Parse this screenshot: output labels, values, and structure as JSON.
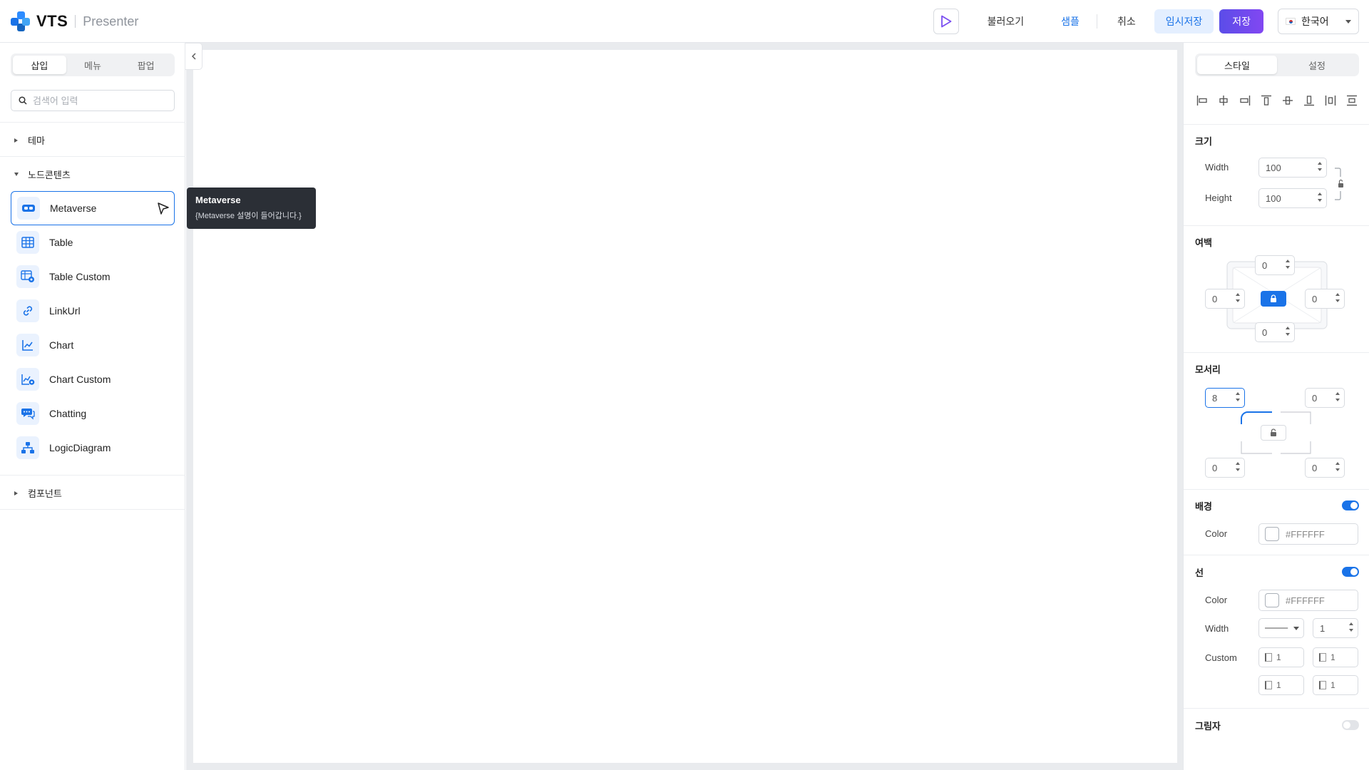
{
  "header": {
    "logo_text": "VTS",
    "logo_sub": "Presenter",
    "load_label": "불러오기",
    "sample_label": "샘플",
    "cancel_label": "취소",
    "temp_save_label": "임시저장",
    "save_label": "저장",
    "language": "한국어"
  },
  "left": {
    "tabs": [
      "삽입",
      "메뉴",
      "팝업"
    ],
    "search_placeholder": "검색어 입력",
    "sections": {
      "theme": "테마",
      "node_contents": "노드콘텐츠",
      "components": "컴포넌트"
    },
    "items": [
      {
        "label": "Metaverse",
        "icon": "vr-headset-icon"
      },
      {
        "label": "Table",
        "icon": "table-icon"
      },
      {
        "label": "Table Custom",
        "icon": "table-custom-icon"
      },
      {
        "label": "LinkUrl",
        "icon": "link-icon"
      },
      {
        "label": "Chart",
        "icon": "chart-icon"
      },
      {
        "label": "Chart Custom",
        "icon": "chart-custom-icon"
      },
      {
        "label": "Chatting",
        "icon": "chat-icon"
      },
      {
        "label": "LogicDiagram",
        "icon": "diagram-icon"
      }
    ]
  },
  "tooltip": {
    "title": "Metaverse",
    "desc": "{Metaverse 설명이 들어갑니다.}"
  },
  "right": {
    "tabs": [
      "스타일",
      "설정"
    ],
    "size": {
      "title": "크기",
      "width_label": "Width",
      "width": "100",
      "height_label": "Height",
      "height": "100"
    },
    "margin": {
      "title": "여백",
      "top": "0",
      "left": "0",
      "right": "0",
      "bottom": "0"
    },
    "corner": {
      "title": "모서리",
      "tl": "8",
      "tr": "0",
      "bl": "0",
      "br": "0"
    },
    "background": {
      "title": "배경",
      "color_label": "Color",
      "color": "#FFFFFF",
      "enabled": true
    },
    "line": {
      "title": "선",
      "color_label": "Color",
      "color": "#FFFFFF",
      "width_label": "Width",
      "width": "1",
      "custom_label": "Custom",
      "custom": [
        "1",
        "1",
        "1",
        "1"
      ],
      "enabled": true
    },
    "shadow": {
      "title": "그림자",
      "enabled": false
    }
  },
  "colors": {
    "accent": "#1a73e8",
    "save_gradient_start": "#5b4de8",
    "save_gradient_end": "#8247f2",
    "tooltip_bg": "#2b2f36"
  }
}
